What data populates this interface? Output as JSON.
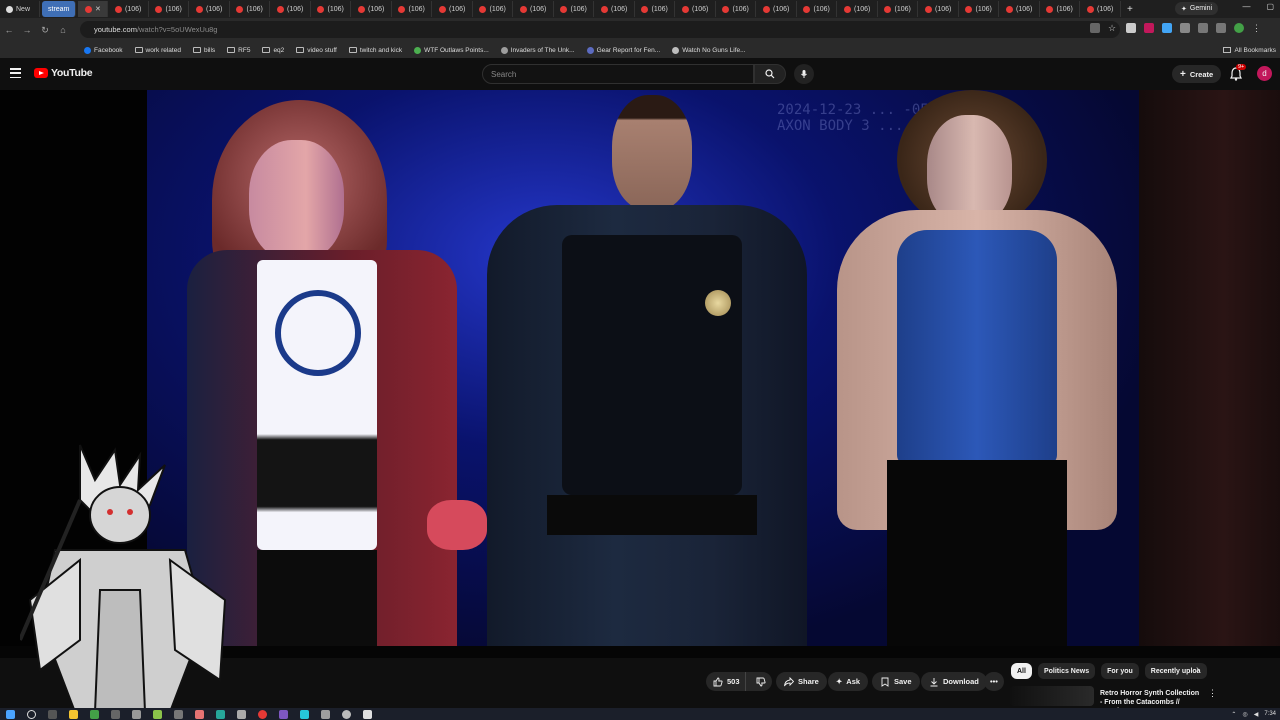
{
  "browser": {
    "tabs": {
      "first": "New",
      "highlighted": "stream",
      "repeated_label": "(106)",
      "repeated_count": 25
    },
    "gemini_label": "Gemini",
    "url_host": "youtube.com",
    "url_path": "/watch?v=5oUWexUu8g",
    "bookmarks": [
      {
        "label": "Facebook",
        "kind": "site",
        "color": "#1877f2"
      },
      {
        "label": "work related",
        "kind": "folder"
      },
      {
        "label": "bills",
        "kind": "folder"
      },
      {
        "label": "RF5",
        "kind": "folder"
      },
      {
        "label": "eq2",
        "kind": "folder"
      },
      {
        "label": "video stuff",
        "kind": "folder"
      },
      {
        "label": "twitch and kick",
        "kind": "folder"
      },
      {
        "label": "WTF Outlaws Points...",
        "kind": "site",
        "color": "#4caf50"
      },
      {
        "label": "Invaders of The Unk...",
        "kind": "site",
        "color": "#9e9e9e"
      },
      {
        "label": "Gear Report for Fen...",
        "kind": "site",
        "color": "#5c6bc0"
      },
      {
        "label": "Watch No Guns Life...",
        "kind": "site",
        "color": "#bdbdbd"
      }
    ],
    "all_bookmarks_label": "All Bookmarks"
  },
  "youtube": {
    "logo_text": "YouTube",
    "search_placeholder": "Search",
    "create_label": "Create",
    "notification_badge": "9+",
    "avatar_letter": "d"
  },
  "video": {
    "overlay_stamp_line1": "2024-12-23 ... -0500",
    "overlay_stamp_line2": "AXON BODY 3 ..."
  },
  "actions": {
    "like_count": "503",
    "share_label": "Share",
    "ask_label": "Ask",
    "save_label": "Save",
    "download_label": "Download"
  },
  "chips": [
    {
      "label": "All",
      "active": true
    },
    {
      "label": "Politics News",
      "active": false
    },
    {
      "label": "For you",
      "active": false
    },
    {
      "label": "Recently uploa",
      "active": false
    }
  ],
  "recommendation": {
    "title": "Retro Horror Synth Collection - From the Catacombs // Royalt..."
  },
  "clock": "7:34"
}
